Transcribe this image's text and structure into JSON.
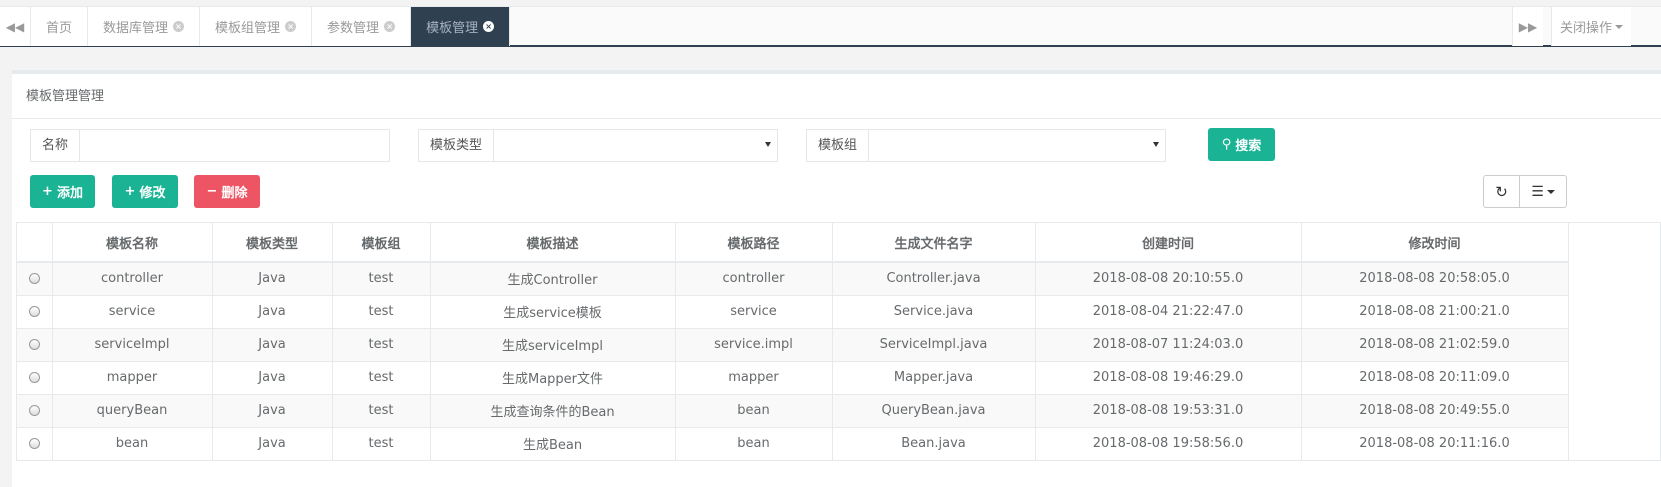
{
  "tabbar": {
    "tabs": [
      {
        "label": "首页",
        "closable": false
      },
      {
        "label": "数据库管理",
        "closable": true
      },
      {
        "label": "模板组管理",
        "closable": true
      },
      {
        "label": "参数管理",
        "closable": true
      },
      {
        "label": "模板管理",
        "closable": true,
        "active": true
      }
    ],
    "close_ops_label": "关闭操作"
  },
  "panel": {
    "title": "模板管理管理"
  },
  "search": {
    "name_label": "名称",
    "name_value": "",
    "type_label": "模板类型",
    "type_value": "",
    "group_label": "模板组",
    "group_value": "",
    "search_button": "搜索"
  },
  "toolbar": {
    "add_label": "添加",
    "edit_label": "修改",
    "delete_label": "删除"
  },
  "table": {
    "headers": [
      "模板名称",
      "模板类型",
      "模板组",
      "模板描述",
      "模板路径",
      "生成文件名字",
      "创建时间",
      "修改时间"
    ],
    "rows": [
      [
        "controller",
        "Java",
        "test",
        "生成Controller",
        "controller",
        "Controller.java",
        "2018-08-08 20:10:55.0",
        "2018-08-08 20:58:05.0"
      ],
      [
        "service",
        "Java",
        "test",
        "生成service模板",
        "service",
        "Service.java",
        "2018-08-04 21:22:47.0",
        "2018-08-08 21:00:21.0"
      ],
      [
        "serviceImpl",
        "Java",
        "test",
        "生成serviceImpl",
        "service.impl",
        "ServiceImpl.java",
        "2018-08-07 11:24:03.0",
        "2018-08-08 21:02:59.0"
      ],
      [
        "mapper",
        "Java",
        "test",
        "生成Mapper文件",
        "mapper",
        "Mapper.java",
        "2018-08-08 19:46:29.0",
        "2018-08-08 20:11:09.0"
      ],
      [
        "queryBean",
        "Java",
        "test",
        "生成查询条件的Bean",
        "bean",
        "QueryBean.java",
        "2018-08-08 19:53:31.0",
        "2018-08-08 20:49:55.0"
      ],
      [
        "bean",
        "Java",
        "test",
        "生成Bean",
        "bean",
        "Bean.java",
        "2018-08-08 19:58:56.0",
        "2018-08-08 20:11:16.0"
      ]
    ]
  },
  "colors": {
    "primary": "#1ab394",
    "danger": "#ed5565",
    "active_tab": "#2f4050"
  }
}
